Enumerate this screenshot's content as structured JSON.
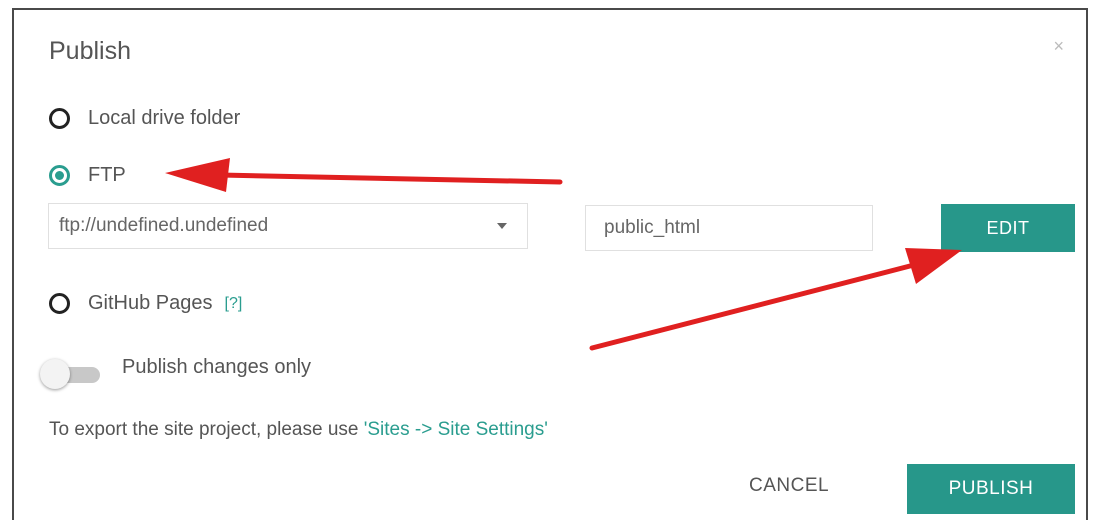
{
  "dialog": {
    "title": "Publish",
    "close_symbol": "×"
  },
  "options": {
    "local": {
      "label": "Local drive folder",
      "checked": false
    },
    "ftp": {
      "label": "FTP",
      "checked": true
    },
    "github": {
      "label": "GitHub Pages",
      "help": "[?]",
      "checked": false
    }
  },
  "ftp_settings": {
    "server_value": "ftp://undefined.undefined",
    "path_value": "public_html",
    "edit_label": "EDIT"
  },
  "toggle": {
    "label": "Publish changes only",
    "on": false
  },
  "info": {
    "prefix": "To export the site project, please use ",
    "link": "'Sites -> Site Settings'"
  },
  "footer": {
    "cancel_label": "CANCEL",
    "publish_label": "PUBLISH"
  },
  "colors": {
    "accent": "#27978a",
    "annotation_arrow": "#e02020"
  },
  "icons": [
    "close-icon",
    "chevron-down-icon",
    "red-annotation-arrow"
  ]
}
